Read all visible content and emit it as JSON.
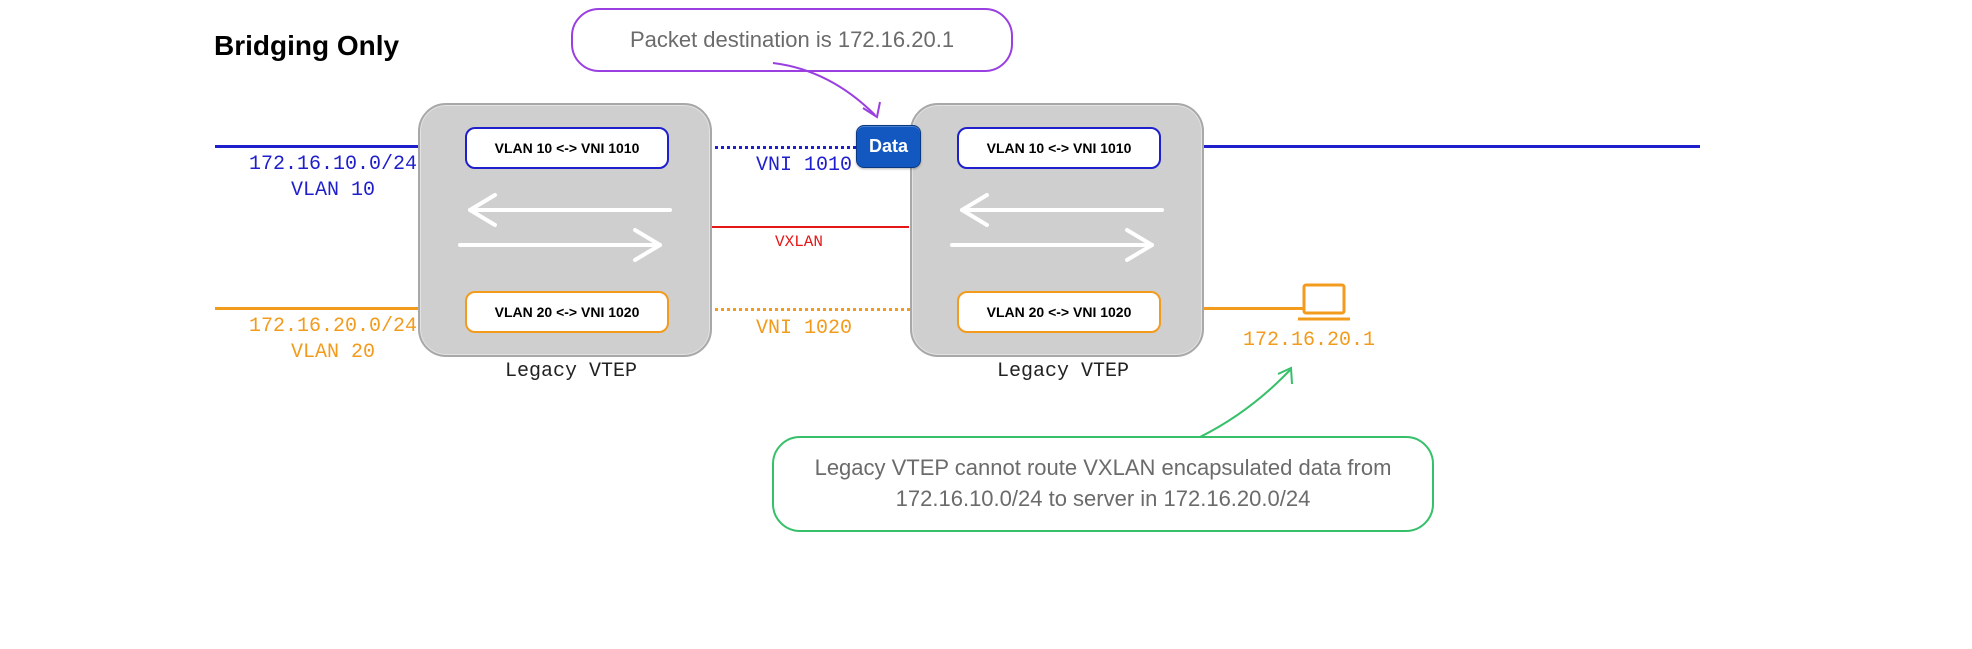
{
  "title": "Bridging Only",
  "vlan10": {
    "subnet": "172.16.10.0/24",
    "vlan": "VLAN 10",
    "vni_label": "VNI 1010",
    "mapping": "VLAN 10 <-> VNI 1010"
  },
  "vlan20": {
    "subnet": "172.16.20.0/24",
    "vlan": "VLAN 20",
    "vni_label": "VNI 1020",
    "mapping": "VLAN 20 <-> VNI 1020"
  },
  "tunnel_label": "VXLAN",
  "data_label": "Data",
  "vtep_label": "Legacy VTEP",
  "callout_top": "Packet destination is 172.16.20.1",
  "callout_bottom": "Legacy VTEP cannot route VXLAN encapsulated data from 172.16.10.0/24 to server in 172.16.20.0/24",
  "server_ip": "172.16.20.1"
}
